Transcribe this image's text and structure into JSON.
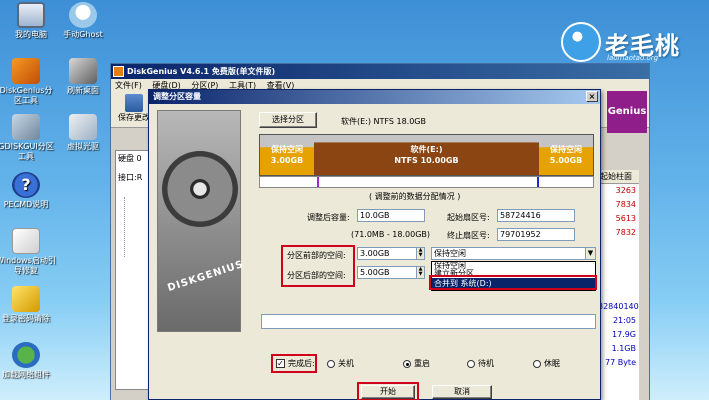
{
  "desktop": {
    "icons": [
      {
        "label": "我的电脑"
      },
      {
        "label": "手动Ghost"
      },
      {
        "label": "DiskGenius分区工具"
      },
      {
        "label": "刷新桌面"
      },
      {
        "label": "GDISKGUI分区工具"
      },
      {
        "label": "虚拟光驱"
      },
      {
        "label": "PECMD说明"
      },
      {
        "label": "Windows启动引导修复"
      },
      {
        "label": "登录密码清除"
      },
      {
        "label": "加载网络组件"
      }
    ]
  },
  "logo": {
    "text": "老毛桃",
    "url": "laomaotao.org"
  },
  "app": {
    "title": "DiskGenius V4.6.1 免费版(单文件版)",
    "menu": [
      "文件(F)",
      "硬盘(D)",
      "分区(P)",
      "工具(T)",
      "查看(V)"
    ],
    "save_label": "保存更改",
    "brand_tile": "Genius",
    "left_labels": [
      "硬盘 0",
      "接口:R"
    ],
    "right_number": "9120",
    "right_head": "起始柱面",
    "right_values": [
      "3263",
      "7834",
      "5613",
      "7832"
    ],
    "right_bottom": [
      "32840140",
      "21:05",
      "17.9G",
      "1.1GB",
      "77 Byte"
    ]
  },
  "dialog": {
    "title": "调整分区容量",
    "close": "×",
    "select_partition_button": "选择分区",
    "partition_info": "软件(E:) NTFS 18.0GB",
    "bar": {
      "left_top": "保持空闲",
      "left_size": "3.00GB",
      "mid_name": "软件(E:)",
      "mid_fs": "NTFS 10.00GB",
      "right_top": "保持空闲",
      "right_size": "5.00GB"
    },
    "before_note": "( 调整前的数据分配情况 )",
    "size_label": "调整后容量:",
    "size_value": "10.0GB",
    "start_label": "起始扇区号:",
    "start_value": "58724416",
    "range_note": "(71.0MB - 18.00GB)",
    "end_label": "终止扇区号:",
    "end_value": "79701952",
    "before_space_label": "分区前部的空间:",
    "before_space_value": "3.00GB",
    "after_space_label": "分区后部的空间:",
    "after_space_value": "5.00GB",
    "dropdown_selected": "保持空闲",
    "dropdown_options": [
      "保持空闲",
      "建立新分区",
      "合并到 系统(D:)"
    ],
    "options": {
      "done_label": "完成后:",
      "shutdown": "关机",
      "restart": "重启",
      "standby": "待机",
      "sleep": "休眠"
    },
    "start_button": "开始",
    "cancel_button": "取消"
  }
}
